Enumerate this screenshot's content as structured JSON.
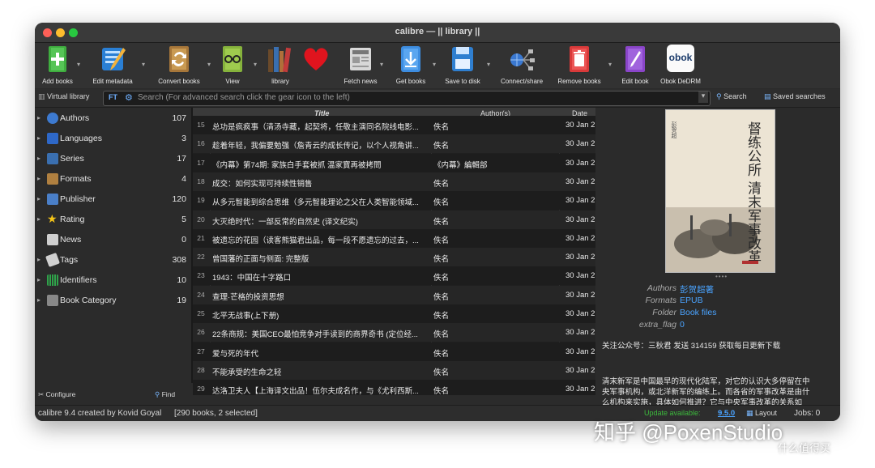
{
  "window": {
    "title": "calibre — || library ||"
  },
  "toolbar": {
    "add_books": "Add books",
    "edit_metadata": "Edit metadata",
    "convert_books": "Convert books",
    "view": "View",
    "library": "library",
    "fetch_news": "Fetch news",
    "get_books": "Get books",
    "save_to_disk": "Save to disk",
    "connect_share": "Connect/share",
    "remove_books": "Remove books",
    "edit_book": "Edit book",
    "obok_icon_text": "obok",
    "obok_dedrm": "Obok DeDRM"
  },
  "searchbar": {
    "virtual_library": "Virtual library",
    "placeholder": "Search (For advanced search click the gear icon to the left)",
    "search_label": "Search",
    "saved_searches": "Saved searches"
  },
  "sidebar": {
    "items": [
      {
        "label": "Authors",
        "count": "107"
      },
      {
        "label": "Languages",
        "count": "3"
      },
      {
        "label": "Series",
        "count": "17"
      },
      {
        "label": "Formats",
        "count": "4"
      },
      {
        "label": "Publisher",
        "count": "120"
      },
      {
        "label": "Rating",
        "count": "5"
      },
      {
        "label": "News",
        "count": "0"
      },
      {
        "label": "Tags",
        "count": "308"
      },
      {
        "label": "Identifiers",
        "count": "10"
      },
      {
        "label": "Book Category",
        "count": "19"
      }
    ],
    "configure": "Configure",
    "find": "Find"
  },
  "table": {
    "headers": {
      "title": "Title",
      "authors": "Author(s)",
      "date": "Date"
    },
    "rows": [
      {
        "num": "15",
        "title": "总功是疯疯事（清汤寺藏，起契将，任敬主演同名院线电影...",
        "author": "佚名",
        "date": "30 Jan 2"
      },
      {
        "num": "16",
        "title": "趁着年轻，我偏要勉强（詹青云的成长传记，以个人视角讲...",
        "author": "佚名",
        "date": "30 Jan 2"
      },
      {
        "num": "17",
        "title": "《内幕》第74期: 家族白手套被抓 温家寶再被拷問",
        "author": "《内幕》編輯部",
        "date": "30 Jan 2"
      },
      {
        "num": "18",
        "title": "成交：如何实现可持续性销售",
        "author": "佚名",
        "date": "30 Jan 2"
      },
      {
        "num": "19",
        "title": "从多元智能到综合思维（多元智能理论之父在人类智能领域...",
        "author": "佚名",
        "date": "30 Jan 2"
      },
      {
        "num": "20",
        "title": "大灭绝时代：一部反常的自然史 (译文纪实)",
        "author": "佚名",
        "date": "30 Jan 2"
      },
      {
        "num": "21",
        "title": "被遗忘的花园（读客熊猫君出品，每一段不愿遗忘的过去，...",
        "author": "佚名",
        "date": "30 Jan 2"
      },
      {
        "num": "22",
        "title": "曾国藩的正面与侧面: 完整版",
        "author": "佚名",
        "date": "30 Jan 2"
      },
      {
        "num": "23",
        "title": "1943：中国在十字路口",
        "author": "佚名",
        "date": "30 Jan 2"
      },
      {
        "num": "24",
        "title": "查理·芒格的投资思想",
        "author": "佚名",
        "date": "30 Jan 2"
      },
      {
        "num": "25",
        "title": "北平无战事(上下册)",
        "author": "佚名",
        "date": "30 Jan 2"
      },
      {
        "num": "26",
        "title": "22条商规：美国CEO最怕竞争对手读到的商界奇书 (定位经...",
        "author": "佚名",
        "date": "30 Jan 2"
      },
      {
        "num": "27",
        "title": "爱与死的年代",
        "author": "佚名",
        "date": "30 Jan 2"
      },
      {
        "num": "28",
        "title": "不能承受的生命之轻",
        "author": "佚名",
        "date": "30 Jan 2"
      },
      {
        "num": "29",
        "title": "达洛卫夫人【上海译文出品！伍尔夫成名作，与《尤利西斯...",
        "author": "佚名",
        "date": "30 Jan 2"
      }
    ]
  },
  "details": {
    "cover_title": "督练公所 清末军事改革",
    "cover_author": "彭贺超",
    "authors_key": "Authors",
    "authors_val": "彭贺超著",
    "formats_key": "Formats",
    "formats_val": "EPUB",
    "folder_key": "Folder",
    "folder_val": "Book files",
    "extra_key": "extra_flag",
    "extra_val": "0",
    "note": "关注公众号：三秋君 发送 314159 获取每日更新下载",
    "desc1": "清末新军是中国最早的现代化陆军，对它的认识大多停留在中",
    "desc2": "央军事机构，或北洋新军的编练上。而各省的军事改革是由什",
    "desc3": "么机构来实施，具体如何推进？它与中央军事改革的关系如"
  },
  "status": {
    "left": "calibre 9.4 created by Kovid Goyal",
    "books": "[290 books, 2 selected]",
    "update": "Update available:",
    "version": "9.5.0",
    "layout": "Layout",
    "jobs": "Jobs: 0"
  },
  "watermark": {
    "text": "知乎 @PoxenStudio",
    "sub": "什么值得买"
  },
  "colors": {
    "accent": "#4aa3ff",
    "update_green": "#3dbb3d",
    "remove_red": "#e23b3b"
  }
}
